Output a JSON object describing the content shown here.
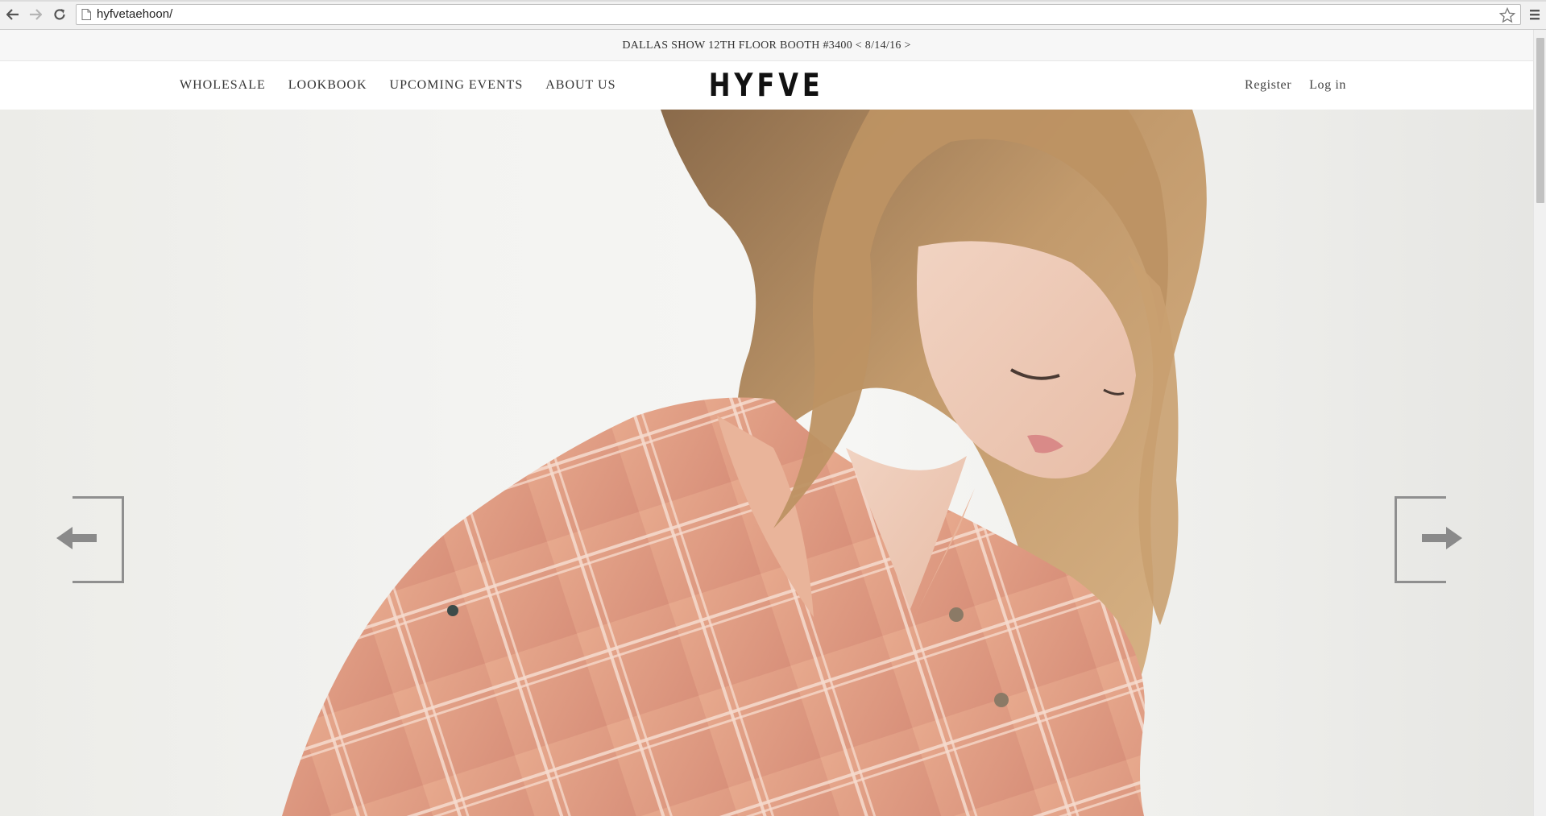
{
  "browser": {
    "url": "hyfvetaehoon/",
    "back_icon": "back-arrow-icon",
    "forward_icon": "forward-arrow-icon",
    "reload_icon": "reload-icon",
    "page_icon": "page-icon",
    "star_icon": "star-icon",
    "menu_icon": "hamburger-menu-icon"
  },
  "announcement": {
    "text": "DALLAS SHOW 12TH FLOOR BOOTH #3400 < 8/14/16 >"
  },
  "header": {
    "nav": [
      {
        "label": "WHOLESALE"
      },
      {
        "label": "LOOKBOOK"
      },
      {
        "label": "UPCOMING EVENTS"
      },
      {
        "label": "ABOUT US"
      }
    ],
    "logo": "HYFVE",
    "account": {
      "register": "Register",
      "login": "Log in"
    }
  },
  "hero": {
    "prev_icon": "left-arrow-icon",
    "next_icon": "right-arrow-icon"
  },
  "colors": {
    "text": "#333333",
    "shirt": "#e3a186",
    "hair": "#b4865a",
    "arrow": "#8a8a8a"
  }
}
